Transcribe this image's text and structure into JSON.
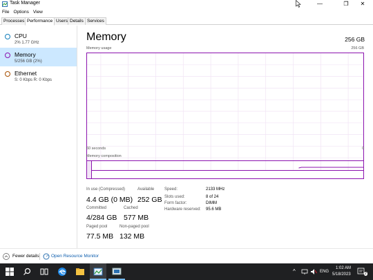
{
  "window": {
    "title": "Task Manager",
    "minimize": "—",
    "maximize": "❐",
    "close": "✕"
  },
  "menu": [
    "File",
    "Options",
    "View"
  ],
  "tabs": [
    "Processes",
    "Performance",
    "Users",
    "Details",
    "Services"
  ],
  "sidebar": [
    {
      "title": "CPU",
      "sub": "2% 1.77 GHz"
    },
    {
      "title": "Memory",
      "sub": "5/256 GB (2%)"
    },
    {
      "title": "Ethernet",
      "sub": "S: 0 Kbps R: 0 Kbps"
    }
  ],
  "main": {
    "title": "Memory",
    "capacity": "256 GB",
    "usage_label": "Memory usage",
    "usage_max": "256 GB",
    "time_left": "60 seconds",
    "time_right": "0",
    "composition_label": "Memory composition"
  },
  "stats": {
    "in_use_label": "In use (Compressed)",
    "in_use_value": "4.4 GB (0 MB)",
    "available_label": "Available",
    "available_value": "252 GB",
    "committed_label": "Committed",
    "committed_value": "4/284 GB",
    "cached_label": "Cached",
    "cached_value": "577 MB",
    "paged_label": "Paged pool",
    "paged_value": "77.5 MB",
    "nonpaged_label": "Non-paged pool",
    "nonpaged_value": "132 MB"
  },
  "info": [
    {
      "label": "Speed:",
      "value": "2133 MHz"
    },
    {
      "label": "Slots used:",
      "value": "8 of 24"
    },
    {
      "label": "Form factor:",
      "value": "DIMM"
    },
    {
      "label": "Hardware reserved:",
      "value": "95.6 MB"
    }
  ],
  "footer": {
    "fewer": "Fewer details",
    "resmon": "Open Resource Monitor"
  },
  "taskbar": {
    "time": "1:02 AM",
    "date": "5/18/2023",
    "lang": "ENG",
    "notif_count": "2"
  },
  "colors": {
    "accent": "#8b12ae",
    "selected": "#cce8ff",
    "taskbar": "#1f2022"
  }
}
